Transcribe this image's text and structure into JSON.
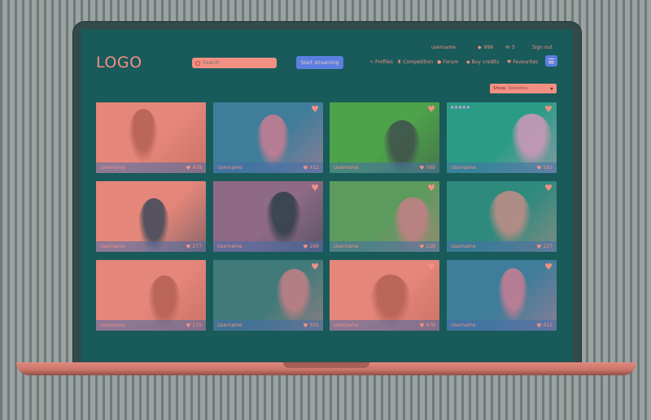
{
  "header": {
    "logo": "LOGO",
    "search_placeholder": "Search",
    "stream_button": "Start streaming",
    "username": "username",
    "diamonds": "999",
    "messages": "5",
    "signout": "Sign out",
    "nav": {
      "profiles": "Profiles",
      "competition": "Competition",
      "forum": "Forum",
      "buy_credits": "Buy credits",
      "favourites": "Favourites"
    }
  },
  "filter": {
    "label": "Show:",
    "selected": "Sessions"
  },
  "cards": [
    {
      "username": "Username",
      "likes": "478",
      "bg": "#e5867a",
      "accent": "#b56055",
      "fav": false,
      "stars": ""
    },
    {
      "username": "Username",
      "likes": "412",
      "bg": "#3f7d9a",
      "accent": "#c97d92",
      "fav": true,
      "stars": ""
    },
    {
      "username": "Username",
      "likes": "569",
      "bg": "#4da34a",
      "accent": "#3f4f4c",
      "fav": true,
      "stars": ""
    },
    {
      "username": "Username",
      "likes": "562",
      "bg": "#2a9c86",
      "accent": "#d197b8",
      "fav": true,
      "stars": "★★★★★"
    },
    {
      "username": "Username",
      "likes": "277",
      "bg": "#e5867a",
      "accent": "#3d4a5a",
      "fav": false,
      "stars": ""
    },
    {
      "username": "Username",
      "likes": "269",
      "bg": "#8e6a86",
      "accent": "#2f3f4a",
      "fav": true,
      "stars": ""
    },
    {
      "username": "Username",
      "likes": "228",
      "bg": "#5c9a5e",
      "accent": "#c47f86",
      "fav": true,
      "stars": ""
    },
    {
      "username": "Username",
      "likes": "227",
      "bg": "#2f8a7e",
      "accent": "#c48d86",
      "fav": true,
      "stars": ""
    },
    {
      "username": "Username",
      "likes": "215",
      "bg": "#e5867a",
      "accent": "#b56055",
      "fav": false,
      "stars": ""
    },
    {
      "username": "Username",
      "likes": "501",
      "bg": "#417a7a",
      "accent": "#c47f86",
      "fav": true,
      "stars": ""
    },
    {
      "username": "Username",
      "likes": "478",
      "bg": "#e5867a",
      "accent": "#b56055",
      "fav": true,
      "stars": ""
    },
    {
      "username": "Username",
      "likes": "412",
      "bg": "#3f7d9a",
      "accent": "#c97d92",
      "fav": true,
      "stars": ""
    }
  ]
}
